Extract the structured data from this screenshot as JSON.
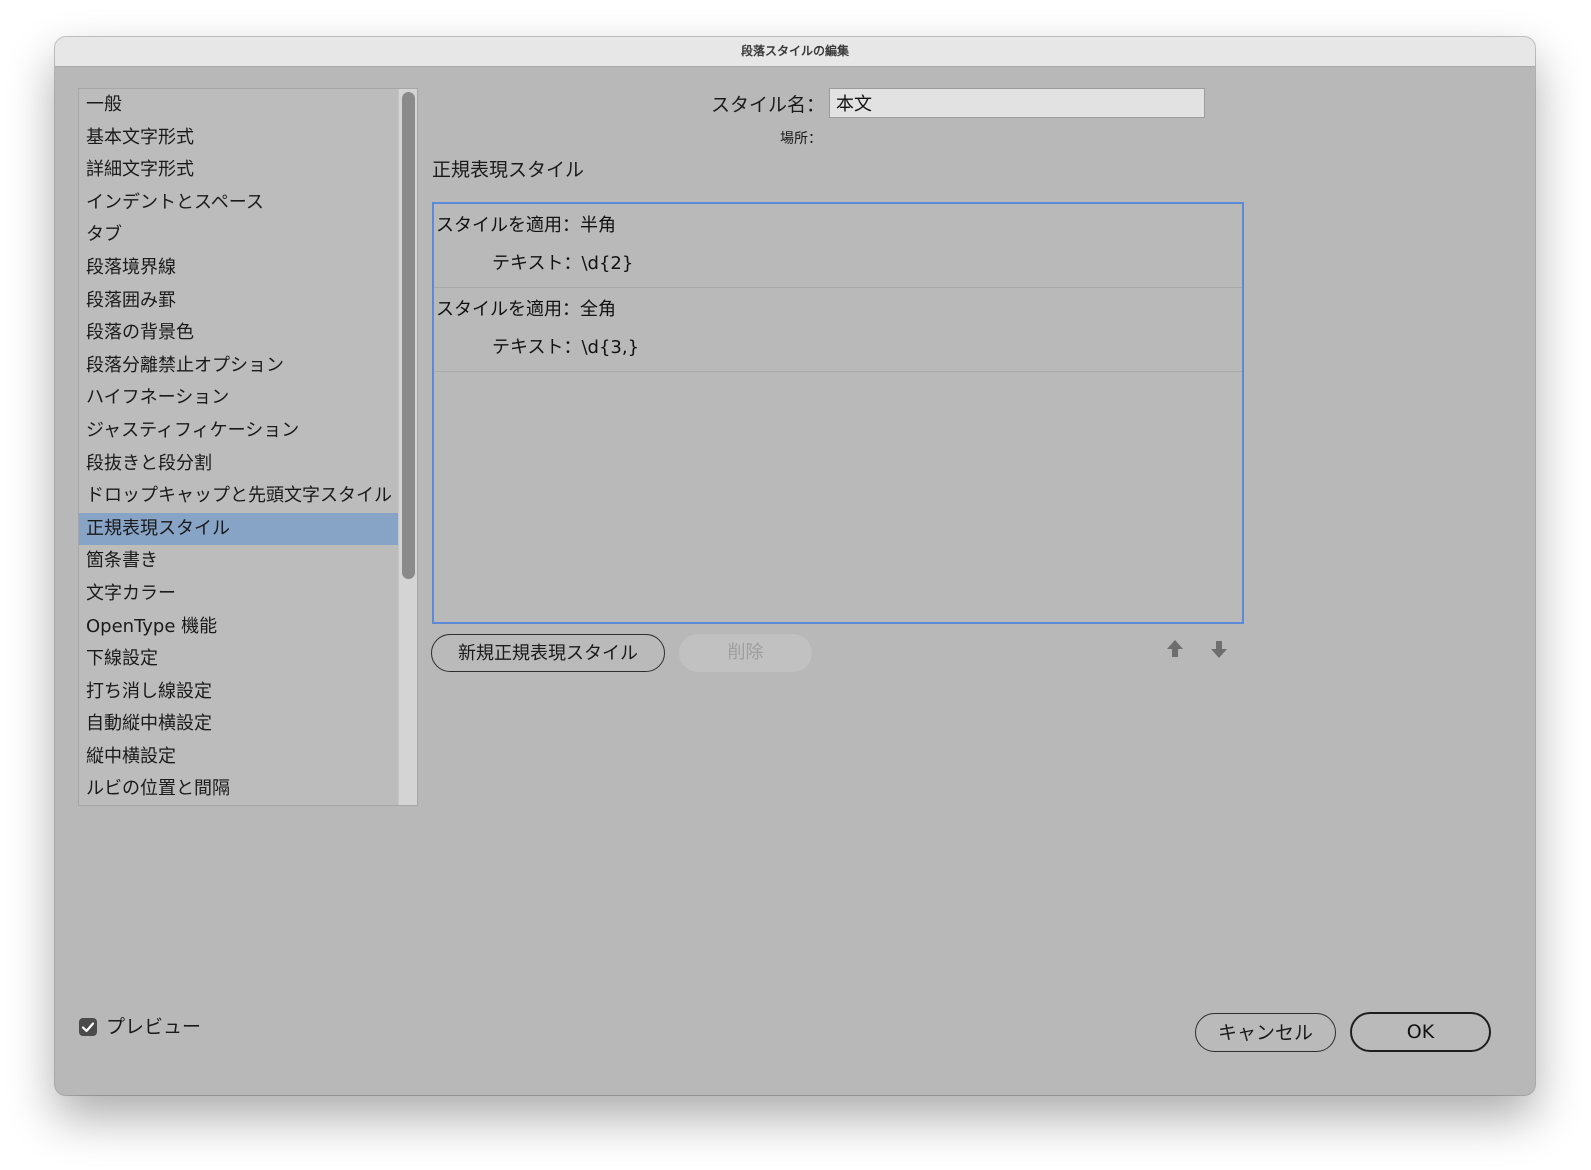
{
  "window": {
    "title": "段落スタイルの編集"
  },
  "sidebar": {
    "items": [
      {
        "label": "一般"
      },
      {
        "label": "基本文字形式"
      },
      {
        "label": "詳細文字形式"
      },
      {
        "label": "インデントとスペース"
      },
      {
        "label": "タブ"
      },
      {
        "label": "段落境界線"
      },
      {
        "label": "段落囲み罫"
      },
      {
        "label": "段落の背景色"
      },
      {
        "label": "段落分離禁止オプション"
      },
      {
        "label": "ハイフネーション"
      },
      {
        "label": "ジャスティフィケーション"
      },
      {
        "label": "段抜きと段分割"
      },
      {
        "label": "ドロップキャップと先頭文字スタイル"
      },
      {
        "label": "正規表現スタイル",
        "selected": true
      },
      {
        "label": "箇条書き"
      },
      {
        "label": "文字カラー"
      },
      {
        "label": "OpenType 機能"
      },
      {
        "label": "下線設定"
      },
      {
        "label": "打ち消し線設定"
      },
      {
        "label": "自動縦中横設定"
      },
      {
        "label": "縦中横設定"
      },
      {
        "label": "ルビの位置と間隔"
      }
    ],
    "selected_color": "#87a3c6"
  },
  "style_name": {
    "label": "スタイル名：",
    "value": "本文"
  },
  "location": {
    "label": "場所："
  },
  "section": {
    "title": "正規表現スタイル"
  },
  "rules": [
    {
      "apply": "スタイルを適用：半角",
      "text": "テキスト：\\d{2}"
    },
    {
      "apply": "スタイルを適用：全角",
      "text": "テキスト：\\d{3,}"
    }
  ],
  "rule_list": {
    "focus_color": "#5c8ad8"
  },
  "buttons": {
    "new_rule": "新規正規表現スタイル",
    "delete": "削除",
    "move_up_icon": "arrow-up-icon",
    "move_down_icon": "arrow-down-icon",
    "cancel": "キャンセル",
    "ok": "OK"
  },
  "preview": {
    "label": "プレビュー",
    "checked": true
  }
}
